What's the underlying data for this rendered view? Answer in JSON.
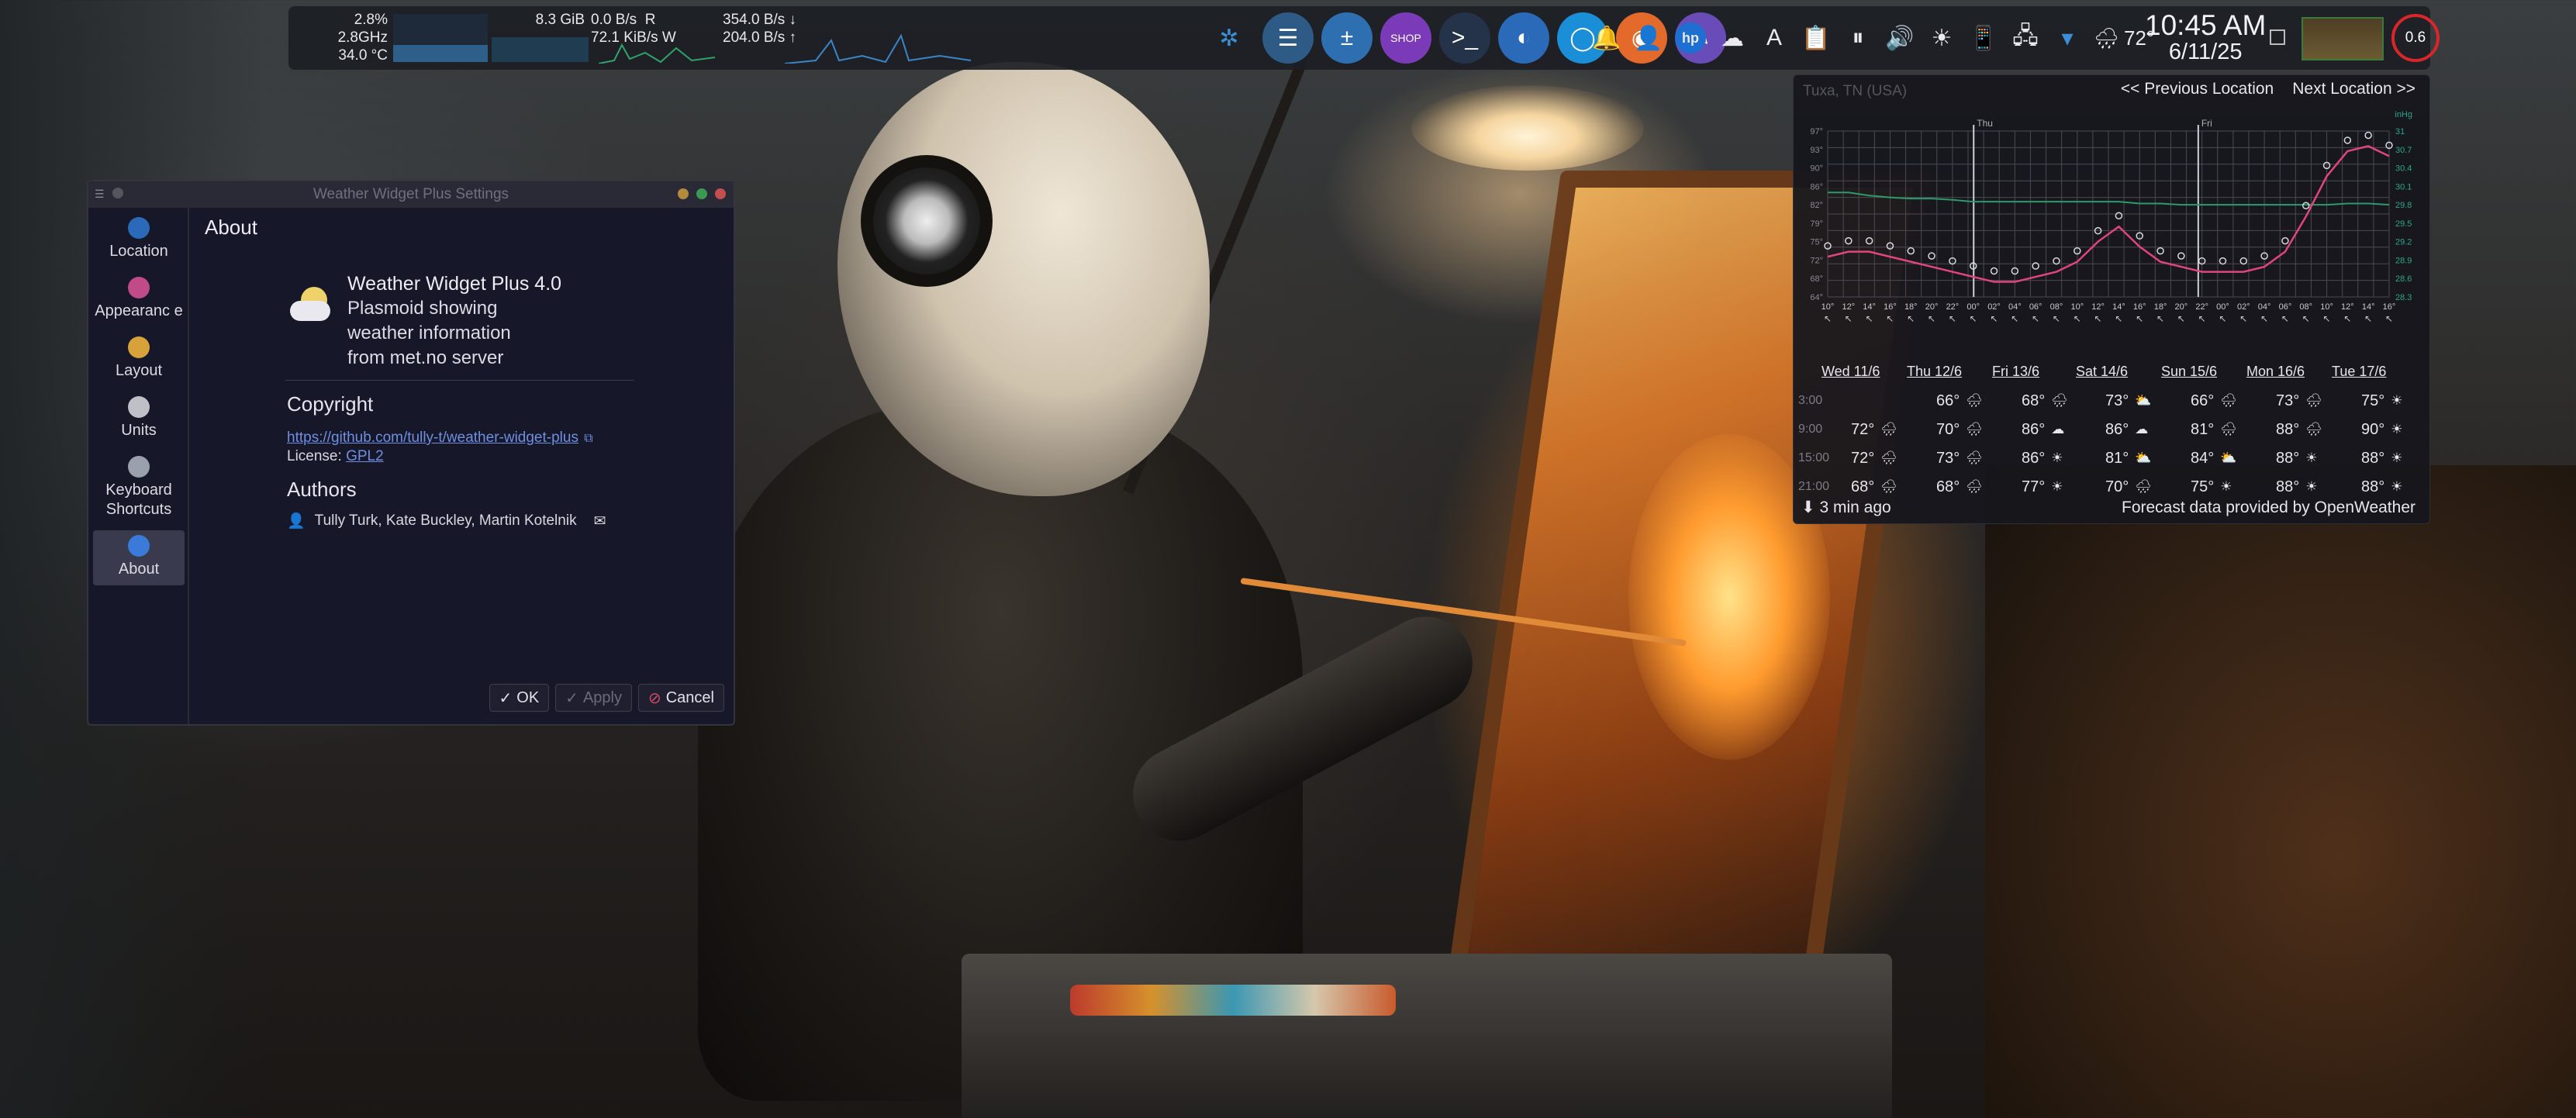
{
  "panel": {
    "cpu": {
      "usage": "2.8%",
      "freq": "2.8GHz",
      "temp": "34.0 °C"
    },
    "memory": {
      "used": "8.3 GiB"
    },
    "disk": {
      "read": "0.0 B/s",
      "read_flag": "R",
      "write": "72.1 KiB/s",
      "write_flag": "W"
    },
    "network": {
      "down": "354.0 B/s ↓",
      "up": "204.0 B/s ↑"
    },
    "apps": [
      {
        "name": "kde-logo-icon",
        "color": "#3b8fd4",
        "glyph": "✲"
      },
      {
        "name": "system-settings-icon",
        "color": "#2d5b86",
        "glyph": "☰"
      },
      {
        "name": "calculator-icon",
        "color": "#2d6fb0",
        "glyph": "±"
      },
      {
        "name": "shop-icon",
        "color": "#7b3bb8",
        "glyph": "SHOP"
      },
      {
        "name": "terminal-icon",
        "color": "#24334a",
        "glyph": ">_"
      },
      {
        "name": "dolphin-icon",
        "color": "#2b6ab8",
        "glyph": "◐"
      },
      {
        "name": "browser-circle-icon",
        "color": "#1a8fd8",
        "glyph": "◯"
      },
      {
        "name": "firefox-icon",
        "color": "#e36a2a",
        "glyph": "◉"
      },
      {
        "name": "color-picker-icon",
        "color": "#6a4cb8",
        "glyph": "✎"
      }
    ],
    "weather": {
      "temp": "72°"
    },
    "clock": {
      "time": "10:45 AM",
      "date": "6/11/25"
    },
    "load": {
      "value": "0.6"
    }
  },
  "settings_window": {
    "title": "Weather Widget Plus Settings",
    "sidebar": [
      {
        "label": "Location",
        "icon": "location-icon",
        "active": false
      },
      {
        "label": "Appearanc e",
        "icon": "appearance-icon",
        "active": false
      },
      {
        "label": "Layout",
        "icon": "layout-icon",
        "active": false
      },
      {
        "label": "Units",
        "icon": "units-icon",
        "active": false
      },
      {
        "label": "Keyboard Shortcuts",
        "icon": "keyboard-icon",
        "active": false
      },
      {
        "label": "About",
        "icon": "info-icon",
        "active": true
      }
    ],
    "page_heading": "About",
    "app_name": "Weather Widget Plus 4.0",
    "app_desc": "Plasmoid showing weather information from met.no server",
    "copyright_heading": "Copyright",
    "url": "https://github.com/tully-t/weather-widget-plus",
    "license_label": "License:",
    "license_value": "GPL2",
    "authors_heading": "Authors",
    "authors": "Tully Turk, Kate Buckley, Martin Kotelnik",
    "buttons": {
      "ok": "OK",
      "apply": "Apply",
      "cancel": "Cancel"
    }
  },
  "weather_popup": {
    "location_text": "Tuxa, TN (USA)",
    "prev": "<< Previous Location",
    "next": "Next Location >>",
    "day_markers": [
      "Thu",
      "Fri"
    ],
    "y_left": [
      "97°",
      "93°",
      "90°",
      "86°",
      "82°",
      "79°",
      "75°",
      "72°",
      "68°",
      "64°"
    ],
    "y_right_unit": "inHg",
    "y_right": [
      "31",
      "30.7",
      "30.4",
      "30.1",
      "29.8",
      "29.5",
      "29.2",
      "28.9",
      "28.6",
      "28.3"
    ],
    "hours": [
      "10°",
      "12°",
      "14°",
      "16°",
      "18°",
      "20°",
      "22°",
      "00°",
      "02°",
      "04°",
      "06°",
      "08°",
      "10°",
      "12°",
      "14°",
      "16°",
      "18°",
      "20°",
      "22°",
      "00°",
      "02°",
      "04°",
      "06°",
      "08°",
      "10°",
      "12°",
      "14°",
      "16°"
    ],
    "temp_curve": [
      72,
      73,
      73,
      72,
      71,
      70,
      69,
      68,
      67,
      67,
      68,
      69,
      71,
      75,
      78,
      74,
      71,
      70,
      69,
      69,
      69,
      70,
      73,
      80,
      88,
      93,
      94,
      92
    ],
    "pressure_curve": [
      30.0,
      30.0,
      29.95,
      29.92,
      29.9,
      29.9,
      29.88,
      29.85,
      29.85,
      29.85,
      29.85,
      29.85,
      29.85,
      29.85,
      29.85,
      29.82,
      29.82,
      29.8,
      29.8,
      29.8,
      29.8,
      29.8,
      29.8,
      29.8,
      29.8,
      29.82,
      29.82,
      29.8
    ],
    "days": [
      "Wed 11/6",
      "Thu 12/6",
      "Fri 13/6",
      "Sat 14/6",
      "Sun 15/6",
      "Mon 16/6",
      "Tue 17/6"
    ],
    "times": [
      "3:00",
      "9:00",
      "15:00",
      "21:00"
    ],
    "grid": [
      [
        "",
        "66°",
        "68°",
        "73°",
        "66°",
        "73°",
        "75°"
      ],
      [
        "72°",
        "70°",
        "86°",
        "86°",
        "81°",
        "88°",
        "90°"
      ],
      [
        "72°",
        "73°",
        "86°",
        "81°",
        "84°",
        "88°",
        "88°"
      ],
      [
        "68°",
        "68°",
        "77°",
        "70°",
        "75°",
        "88°",
        "88°"
      ]
    ],
    "icons": [
      [
        "",
        "rain",
        "rain",
        "partly-cloudy",
        "rain",
        "rain",
        "sun"
      ],
      [
        "rain",
        "rain",
        "cloud",
        "cloud",
        "rain",
        "rain",
        "sun"
      ],
      [
        "rain",
        "rain",
        "sun",
        "partly-cloudy",
        "partly-cloudy",
        "sun",
        "sun"
      ],
      [
        "rain",
        "rain",
        "sun",
        "rain",
        "sun",
        "sun",
        "sun"
      ]
    ],
    "updated": "3 min ago",
    "provider": "Forecast data provided by OpenWeather"
  }
}
